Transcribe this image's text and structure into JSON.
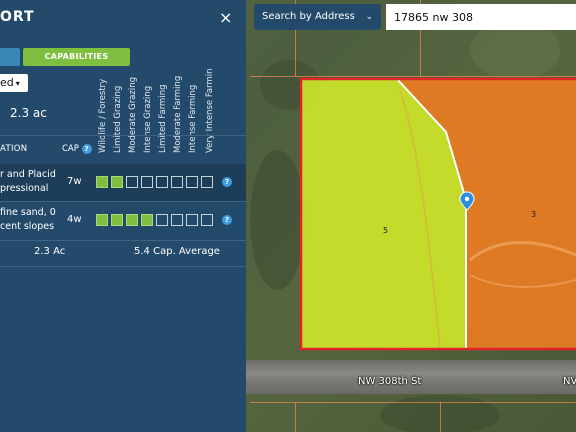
{
  "panel": {
    "title": "ORT",
    "close": "×",
    "tabs": {
      "left": "",
      "capabilities": "CAPABILITIES"
    },
    "dropdown": {
      "value": "ed",
      "caret": "▾"
    },
    "acres": "2.3 ac",
    "col_headers": [
      "Wildlife / Forestry",
      "Limited Grazing",
      "Moderate Grazing",
      "Intense Grazing",
      "Limited Farming",
      "Moderate Farming",
      "Intense Farming",
      "Very Intense Farmin"
    ],
    "header_left": "ATION",
    "header_cap": "CAP",
    "help_glyph": "?",
    "rows": [
      {
        "soil_line1": "r and Placid",
        "soil_line2": "pressional",
        "cap": "7w",
        "filled": [
          true,
          true,
          false,
          false,
          false,
          false,
          false,
          false
        ]
      },
      {
        "soil_line1": " fine sand, 0",
        "soil_line2": "cent slopes",
        "cap": "4w",
        "filled": [
          true,
          true,
          true,
          true,
          false,
          false,
          false,
          false
        ]
      }
    ],
    "totals": {
      "acres": "2.3 Ac",
      "average": "5.4 Cap. Average"
    }
  },
  "search": {
    "type_label": "Search by Address",
    "chevron": "⌄",
    "query": "17865 nw 308"
  },
  "map": {
    "parcels": [
      {
        "label": "5",
        "color": "#d4ec2a"
      },
      {
        "label": "3",
        "color": "#f07d20"
      }
    ],
    "road_label": "NW 308th St",
    "road_label_right": "NV",
    "border_color": "#e0242a",
    "pin_color": "#2f8fde"
  }
}
